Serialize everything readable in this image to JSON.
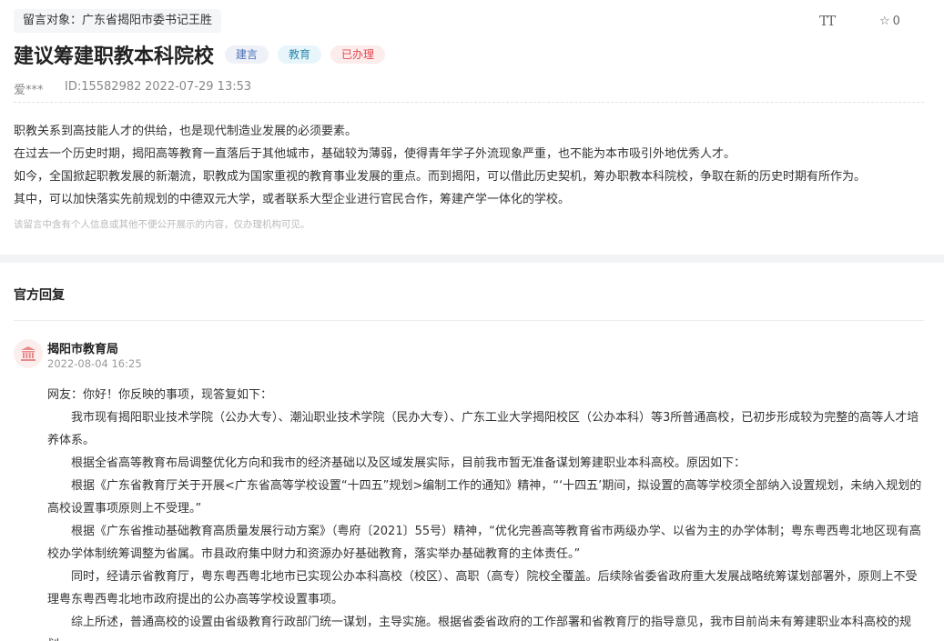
{
  "header": {
    "target": "留言对象：广东省揭阳市委书记王胜",
    "title": "建议筹建职教本科院校",
    "badges": [
      "建言",
      "教育",
      "已办理"
    ],
    "font_button": "TT",
    "favorite_count": "0"
  },
  "meta": {
    "user": "爱***",
    "id": "ID:15582982",
    "datetime": "2022-07-29 13:53"
  },
  "message": {
    "lines": [
      "职教关系到高技能人才的供给，也是现代制造业发展的必须要素。",
      "在过去一个历史时期，揭阳高等教育一直落后于其他城市，基础较为薄弱，使得青年学子外流现象严重，也不能为本市吸引外地优秀人才。",
      "如今，全国掀起职教发展的新潮流，职教成为国家重视的教育事业发展的重点。而到揭阳，可以借此历史契机，筹办职教本科院校，争取在新的历史时期有所作为。",
      "其中，可以加快落实先前规划的中德双元大学，或者联系大型企业进行官民合作，筹建产学一体化的学校。"
    ],
    "notice": "该留言中含有个人信息或其他不便公开展示的内容，仅办理机构可见。"
  },
  "reply": {
    "heading": "官方回复",
    "org": "揭阳市教育局",
    "datetime": "2022-08-04 16:25",
    "greeting": "网友：你好！你反映的事项，现答复如下：",
    "paragraphs": [
      "我市现有揭阳职业技术学院（公办大专）、潮汕职业技术学院（民办大专）、广东工业大学揭阳校区（公办本科）等3所普通高校，已初步形成较为完整的高等人才培养体系。",
      "根据全省高等教育布局调整优化方向和我市的经济基础以及区域发展实际，目前我市暂无准备谋划筹建职业本科高校。原因如下：",
      "根据《广东省教育厅关于开展<广东省高等学校设置“十四五”规划>编制工作的通知》精神，“‘十四五’期间，拟设置的高等学校须全部纳入设置规划，未纳入规划的高校设置事项原则上不受理。”",
      "根据《广东省推动基础教育高质量发展行动方案》（粤府〔2021〕55号）精神，“优化完善高等教育省市两级办学、以省为主的办学体制；粤东粤西粤北地区现有高校办学体制统筹调整为省属。市县政府集中财力和资源办好基础教育，落实举办基础教育的主体责任。”",
      "同时，经请示省教育厅，粤东粤西粤北地市已实现公办本科高校（校区）、高职（高专）院校全覆盖。后续除省委省政府重大发展战略统筹谋划部署外，原则上不受理粤东粤西粤北地市政府提出的公办高等学校设置事项。",
      "综上所述，普通高校的设置由省级教育行政部门统一谋划，主导实施。根据省委省政府的工作部署和省教育厅的指导意见，我市目前尚未有筹建职业本科高校的规划。"
    ]
  },
  "icons": {
    "avatar": "government-building-icon",
    "favorite": "star-outline-icon",
    "font_size": "font-size-icon"
  },
  "colors": {
    "badge_suggest": "#4a6fb5",
    "badge_education": "#2a8ab0",
    "badge_done": "#e0484e",
    "avatar_icon": "#e88a8a"
  }
}
